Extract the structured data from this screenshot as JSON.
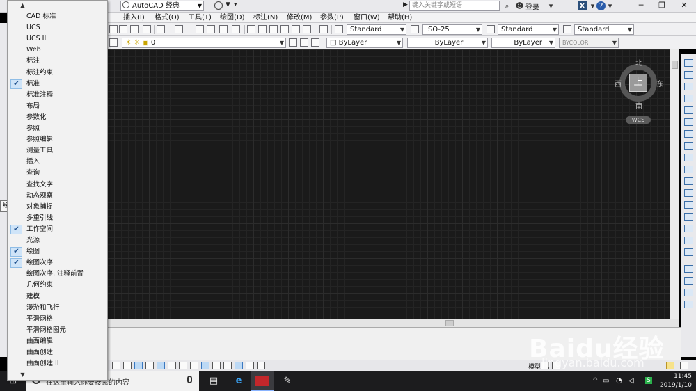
{
  "titlebar": {
    "workspace": "AutoCAD 经典",
    "search_placeholder": "键入关键字或短语",
    "login": "登录"
  },
  "menubar": {
    "items": [
      "插入(I)",
      "格式(O)",
      "工具(T)",
      "绘图(D)",
      "标注(N)",
      "修改(M)",
      "参数(P)",
      "窗口(W)",
      "帮助(H)"
    ]
  },
  "styles": {
    "text_style": "Standard",
    "dim_style": "ISO-25",
    "table_style": "Standard",
    "mleader_style": "Standard"
  },
  "layers": {
    "current_layer": "0",
    "color": "ByLayer",
    "linetype": "ByLayer",
    "lineweight": "ByLayer",
    "plotstyle": "BYCOLOR"
  },
  "left_tooltip": "绘图",
  "viewcube": {
    "face": "上",
    "north": "北",
    "south": "南",
    "east": "东",
    "west": "西",
    "ucs": "WCS"
  },
  "status": {
    "model": "模型"
  },
  "context_menu": {
    "items": [
      {
        "label": "CAD 标准",
        "checked": false
      },
      {
        "label": "UCS",
        "checked": false
      },
      {
        "label": "UCS II",
        "checked": false
      },
      {
        "label": "Web",
        "checked": false
      },
      {
        "label": "标注",
        "checked": false
      },
      {
        "label": "标注约束",
        "checked": false
      },
      {
        "label": "标准",
        "checked": true
      },
      {
        "label": "标准注释",
        "checked": false
      },
      {
        "label": "布局",
        "checked": false
      },
      {
        "label": "参数化",
        "checked": false
      },
      {
        "label": "参照",
        "checked": false
      },
      {
        "label": "参照编辑",
        "checked": false
      },
      {
        "label": "测量工具",
        "checked": false
      },
      {
        "label": "插入",
        "checked": false
      },
      {
        "label": "查询",
        "checked": false
      },
      {
        "label": "查找文字",
        "checked": false
      },
      {
        "label": "动态观察",
        "checked": false
      },
      {
        "label": "对象捕捉",
        "checked": false
      },
      {
        "label": "多重引线",
        "checked": false
      },
      {
        "label": "工作空间",
        "checked": true
      },
      {
        "label": "光源",
        "checked": false
      },
      {
        "label": "绘图",
        "checked": true
      },
      {
        "label": "绘图次序",
        "checked": true
      },
      {
        "label": "绘图次序, 注释前置",
        "checked": false
      },
      {
        "label": "几何约束",
        "checked": false
      },
      {
        "label": "建模",
        "checked": false
      },
      {
        "label": "漫游和飞行",
        "checked": false
      },
      {
        "label": "平滑网格",
        "checked": false
      },
      {
        "label": "平滑网格图元",
        "checked": false
      },
      {
        "label": "曲面编辑",
        "checked": false
      },
      {
        "label": "曲面创建",
        "checked": false
      },
      {
        "label": "曲面创建 II",
        "checked": false
      }
    ]
  },
  "taskbar": {
    "search_text": "在这里输入你要搜索的内容",
    "time": "11:45",
    "date": "2019/1/10"
  },
  "watermark": {
    "logo": "Baidu经验",
    "url": "jingyan.baidu.com"
  }
}
